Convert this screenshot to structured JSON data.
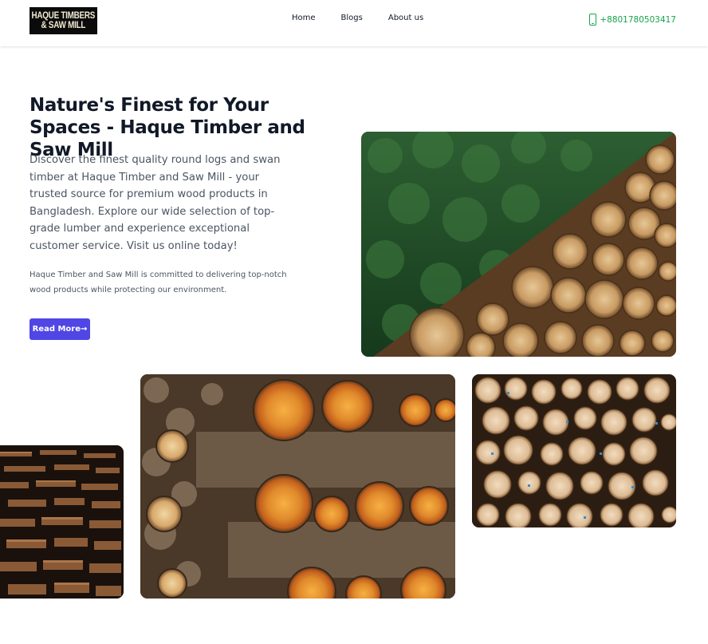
{
  "header": {
    "logo": {
      "line1": "HAQUE TIMBERS",
      "line2": "& SAW MILL"
    },
    "nav": [
      "Home",
      "Blogs",
      "About us"
    ],
    "phone": "+8801780503417",
    "phone_icon": "mobile-phone-icon"
  },
  "hero": {
    "title": "Nature's Finest for Your Spaces - Haque Timber and Saw Mill",
    "description": "Discover the finest quality round logs and swan timber at Haque Timber and Saw Mill - your trusted source for premium wood products in Bangladesh. Explore our wide selection of top-grade lumber and experience exceptional customer service. Visit us online today!",
    "note": "Haque Timber and Saw Mill is committed to delivering top-notch wood products while protecting our environment.",
    "button": "Read More→"
  },
  "colors": {
    "accent": "#4f46e5",
    "phone": "#16a34a",
    "text": "#111827",
    "muted": "#4b5563"
  }
}
